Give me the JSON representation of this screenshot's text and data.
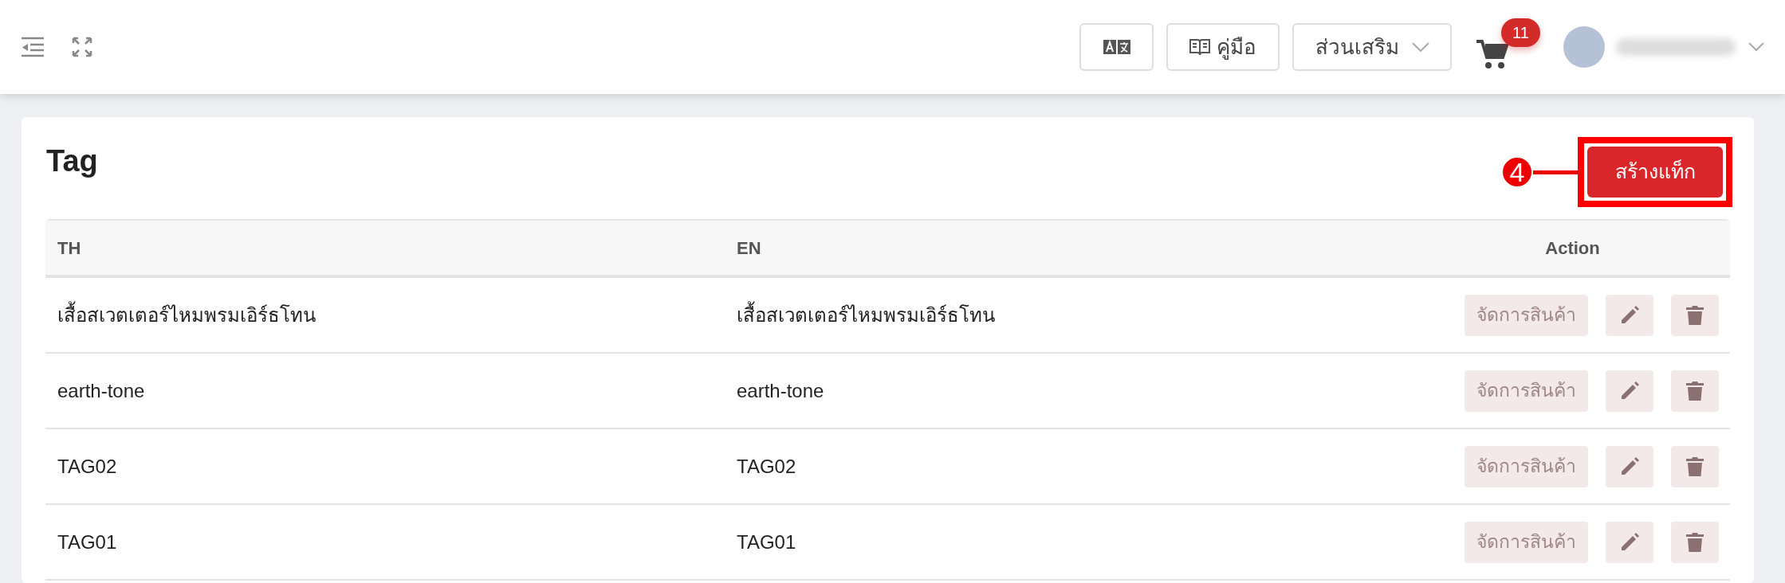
{
  "header": {
    "guide_button": "คู่มือ",
    "addons_button": "ส่วนเสริม",
    "cart_count": "11"
  },
  "page": {
    "title": "Tag",
    "create_button": "สร้างแท็ก",
    "callout": "4"
  },
  "table": {
    "columns": [
      "TH",
      "EN",
      "Action"
    ],
    "rows": [
      {
        "th": "เสื้อสเวตเตอร์ไหมพรมเอิร์ธโทน",
        "en": "เสื้อสเวตเตอร์ไหมพรมเอิร์ธโทน",
        "manage_button": "จัดการสินค้า"
      },
      {
        "th": "earth-tone",
        "en": "earth-tone",
        "manage_button": "จัดการสินค้า"
      },
      {
        "th": "TAG02",
        "en": "TAG02",
        "manage_button": "จัดการสินค้า"
      },
      {
        "th": "TAG01",
        "en": "TAG01",
        "manage_button": "จัดการสินค้า"
      }
    ]
  }
}
